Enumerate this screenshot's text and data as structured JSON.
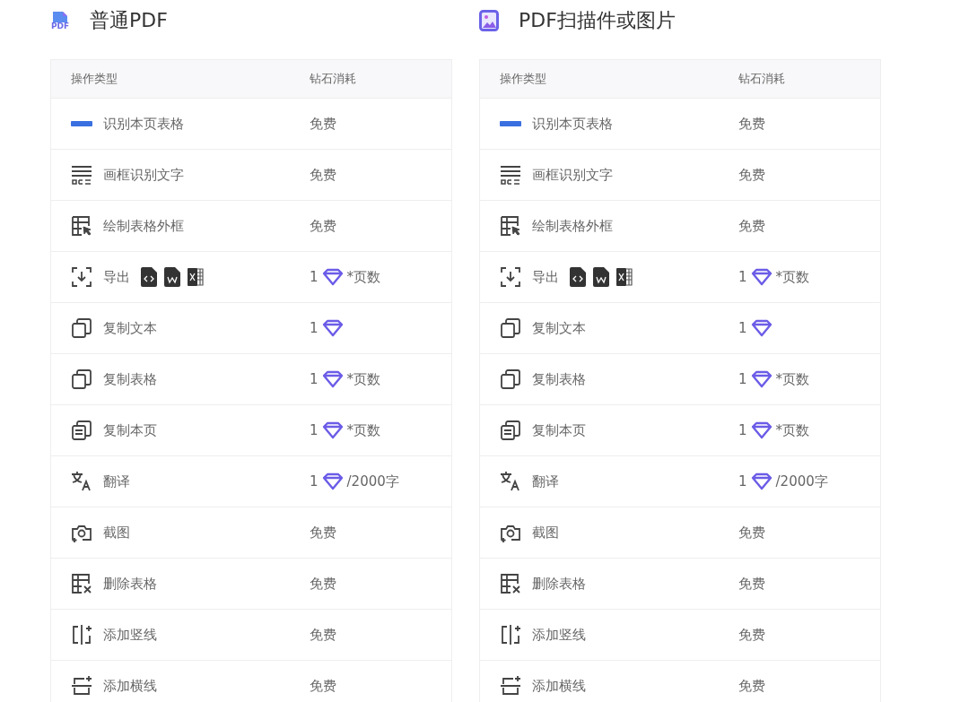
{
  "panels": [
    {
      "title": "普通PDF",
      "kind": "pdf",
      "title_icon_text": "PDF",
      "columns": [
        "操作类型",
        "钻石消耗"
      ],
      "rows": [
        {
          "kind": "table-recognize",
          "label": "识别本页表格",
          "cost": {
            "kind": "free",
            "text": "免费"
          }
        },
        {
          "kind": "ocr",
          "label": "画框识别文字",
          "cost": {
            "kind": "free",
            "text": "免费"
          }
        },
        {
          "kind": "draw-frame",
          "label": "绘制表格外框",
          "cost": {
            "kind": "free",
            "text": "免费"
          }
        },
        {
          "kind": "export",
          "label": "导出",
          "cost": {
            "kind": "diamond",
            "count": "1",
            "suffix": "*页数"
          }
        },
        {
          "kind": "copy",
          "label": "复制文本",
          "cost": {
            "kind": "diamond",
            "count": "1"
          }
        },
        {
          "kind": "copy",
          "label": "复制表格",
          "cost": {
            "kind": "diamond",
            "count": "1",
            "suffix": "*页数"
          }
        },
        {
          "kind": "copy-page",
          "label": "复制本页",
          "cost": {
            "kind": "diamond",
            "count": "1",
            "suffix": "*页数"
          }
        },
        {
          "kind": "translate",
          "label": "翻译",
          "cost": {
            "kind": "diamond",
            "count": "1",
            "suffix": "/2000字"
          }
        },
        {
          "kind": "screenshot",
          "label": "截图",
          "cost": {
            "kind": "free",
            "text": "免费"
          }
        },
        {
          "kind": "delete-table",
          "label": "删除表格",
          "cost": {
            "kind": "free",
            "text": "免费"
          }
        },
        {
          "kind": "add-vline",
          "label": "添加竖线",
          "cost": {
            "kind": "free",
            "text": "免费"
          }
        },
        {
          "kind": "add-hline",
          "label": "添加横线",
          "cost": {
            "kind": "free",
            "text": "免费"
          }
        }
      ]
    },
    {
      "title": "PDF扫描件或图片",
      "kind": "image",
      "columns": [
        "操作类型",
        "钻石消耗"
      ],
      "rows": [
        {
          "kind": "table-recognize",
          "label": "识别本页表格",
          "cost": {
            "kind": "free",
            "text": "免费"
          }
        },
        {
          "kind": "ocr",
          "label": "画框识别文字",
          "cost": {
            "kind": "free",
            "text": "免费"
          }
        },
        {
          "kind": "draw-frame",
          "label": "绘制表格外框",
          "cost": {
            "kind": "free",
            "text": "免费"
          }
        },
        {
          "kind": "export",
          "label": "导出",
          "cost": {
            "kind": "diamond",
            "count": "1",
            "suffix": "*页数"
          }
        },
        {
          "kind": "copy",
          "label": "复制文本",
          "cost": {
            "kind": "diamond",
            "count": "1"
          }
        },
        {
          "kind": "copy",
          "label": "复制表格",
          "cost": {
            "kind": "diamond",
            "count": "1",
            "suffix": "*页数"
          }
        },
        {
          "kind": "copy-page",
          "label": "复制本页",
          "cost": {
            "kind": "diamond",
            "count": "1",
            "suffix": "*页数"
          }
        },
        {
          "kind": "translate",
          "label": "翻译",
          "cost": {
            "kind": "diamond",
            "count": "1",
            "suffix": "/2000字"
          }
        },
        {
          "kind": "screenshot",
          "label": "截图",
          "cost": {
            "kind": "free",
            "text": "免费"
          }
        },
        {
          "kind": "delete-table",
          "label": "删除表格",
          "cost": {
            "kind": "free",
            "text": "免费"
          }
        },
        {
          "kind": "add-vline",
          "label": "添加竖线",
          "cost": {
            "kind": "free",
            "text": "免费"
          }
        },
        {
          "kind": "add-hline",
          "label": "添加横线",
          "cost": {
            "kind": "free",
            "text": "免费"
          }
        }
      ]
    }
  ]
}
